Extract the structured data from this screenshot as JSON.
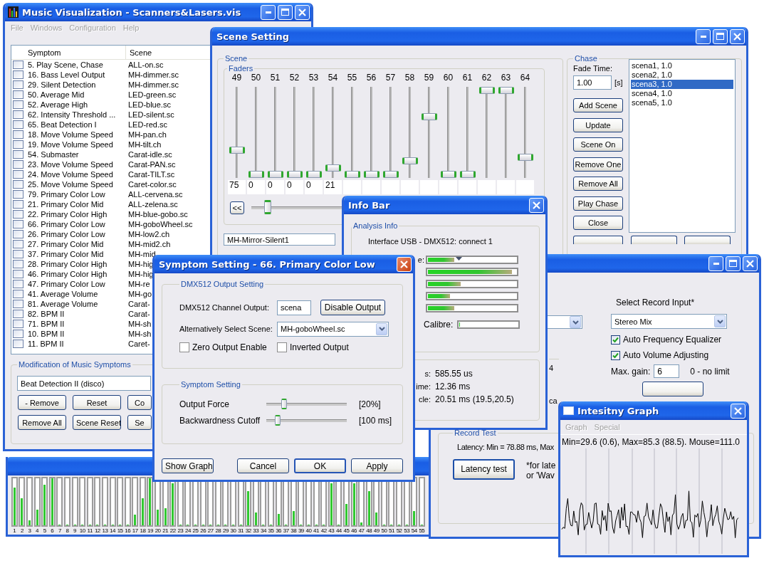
{
  "main_window": {
    "title": "Music Visualization - Scanners&Lasers.vis",
    "menu": [
      {
        "label": "File",
        "disabled": true
      },
      {
        "label": "Windows",
        "disabled": true
      },
      {
        "label": "Configuration",
        "disabled": true
      },
      {
        "label": "Help",
        "disabled": true
      }
    ],
    "list": {
      "columns": [
        "Symptom",
        "Scene"
      ],
      "rows": [
        {
          "symptom": "5. Play Scene, Chase",
          "scene": "ALL-on.sc",
          "checked": false
        },
        {
          "symptom": "16. Bass Level Output",
          "scene": "MH-dimmer.sc",
          "checked": false
        },
        {
          "symptom": "29. Silent Detection",
          "scene": "MH-dimmer.sc",
          "checked": false
        },
        {
          "symptom": "50. Average Mid",
          "scene": "LED-green.sc",
          "checked": false
        },
        {
          "symptom": "52. Average High",
          "scene": "LED-blue.sc",
          "checked": false
        },
        {
          "symptom": "62. Intensity Threshold ...",
          "scene": "LED-silent.sc",
          "checked": false
        },
        {
          "symptom": "65. Beat Detection I",
          "scene": "LED-red.sc",
          "checked": false
        },
        {
          "symptom": "18. Move Volume Speed",
          "scene": "MH-pan.ch",
          "checked": false
        },
        {
          "symptom": "19. Move Volume Speed",
          "scene": "MH-tilt.ch",
          "checked": false
        },
        {
          "symptom": "54. Submaster",
          "scene": "Carat-idle.sc",
          "checked": false
        },
        {
          "symptom": "23. Move Volume Speed",
          "scene": "Carat-PAN.sc",
          "checked": false
        },
        {
          "symptom": "24. Move Volume Speed",
          "scene": "Carat-TILT.sc",
          "checked": false
        },
        {
          "symptom": "25. Move Volume Speed",
          "scene": "Caret-color.sc",
          "checked": false
        },
        {
          "symptom": "79. Primary Color Low",
          "scene": "ALL-cervena.sc",
          "checked": false
        },
        {
          "symptom": "21. Primary Color Mid",
          "scene": "ALL-zelena.sc",
          "checked": false
        },
        {
          "symptom": "22. Primary Color High",
          "scene": "MH-blue-gobo.sc",
          "checked": false
        },
        {
          "symptom": "66. Primary Color Low",
          "scene": "MH-goboWheel.sc",
          "checked": false
        },
        {
          "symptom": "26. Primary Color Low",
          "scene": "MH-low2.ch",
          "checked": false
        },
        {
          "symptom": "27. Primary Color Mid",
          "scene": "MH-mid2.ch",
          "checked": false
        },
        {
          "symptom": "37. Primary Color Mid",
          "scene": "MH-mid",
          "checked": false
        },
        {
          "symptom": "28. Primary Color High",
          "scene": "MH-hig",
          "checked": false
        },
        {
          "symptom": "46. Primary Color High",
          "scene": "MH-hig",
          "checked": false
        },
        {
          "symptom": "47. Primary Color Low",
          "scene": "MH-re",
          "checked": false
        },
        {
          "symptom": "41. Average Volume",
          "scene": "MH-go",
          "checked": false
        },
        {
          "symptom": "81. Average Volume",
          "scene": "Carat-",
          "checked": false
        },
        {
          "symptom": "82. BPM II",
          "scene": "Carat-",
          "checked": false
        },
        {
          "symptom": "71. BPM II",
          "scene": "MH-sh",
          "checked": false
        },
        {
          "symptom": "10. BPM II",
          "scene": "MH-sh",
          "checked": false
        },
        {
          "symptom": "11. BPM II",
          "scene": "Caret-",
          "checked": false
        }
      ]
    },
    "modification": {
      "title": "Modification of Music Symptoms",
      "value": "Beat Detection II (disco)",
      "buttons": [
        "- Remove",
        "Reset",
        "Co",
        "Remove All",
        "Scene Reset",
        "Se"
      ]
    }
  },
  "meter_window": {
    "channels": [
      {
        "label": "1",
        "level": 0.8
      },
      {
        "label": "2",
        "level": 0.57
      },
      {
        "label": "3",
        "level": 0.1
      },
      {
        "label": "4",
        "level": 0.34
      },
      {
        "label": "5",
        "level": 0.87
      },
      {
        "label": "6",
        "level": 1
      },
      {
        "label": "7",
        "level": 0
      },
      {
        "label": "8",
        "level": 0
      },
      {
        "label": "9",
        "level": 0
      },
      {
        "label": "10",
        "level": 0
      },
      {
        "label": "11",
        "level": 0
      },
      {
        "label": "12",
        "level": 0
      },
      {
        "label": "13",
        "level": 0
      },
      {
        "label": "14",
        "level": 0
      },
      {
        "label": "15",
        "level": 0
      },
      {
        "label": "16",
        "level": 0
      },
      {
        "label": "17",
        "level": 0.22
      },
      {
        "label": "18",
        "level": 0.57
      },
      {
        "label": "19",
        "level": 1
      },
      {
        "label": "20",
        "level": 0.34
      },
      {
        "label": "21",
        "level": 0.36
      },
      {
        "label": "22",
        "level": 0.9
      },
      {
        "label": "23",
        "level": 0
      },
      {
        "label": "24",
        "level": 0
      },
      {
        "label": "25",
        "level": 0
      },
      {
        "label": "26",
        "level": 0
      },
      {
        "label": "27",
        "level": 0
      },
      {
        "label": "28",
        "level": 0
      },
      {
        "label": "29",
        "level": 0
      },
      {
        "label": "30",
        "level": 0
      },
      {
        "label": "31",
        "level": 0
      },
      {
        "label": "32",
        "level": 0.73
      },
      {
        "label": "33",
        "level": 0.27
      },
      {
        "label": "34",
        "level": 0
      },
      {
        "label": "35",
        "level": 0
      },
      {
        "label": "36",
        "level": 0.24
      },
      {
        "label": "37",
        "level": 0
      },
      {
        "label": "38",
        "level": 0.31
      },
      {
        "label": "39",
        "level": 0
      },
      {
        "label": "40",
        "level": 0
      },
      {
        "label": "41",
        "level": 0
      },
      {
        "label": "42",
        "level": 0
      },
      {
        "label": "43",
        "level": 0.9
      },
      {
        "label": "44",
        "level": 0
      },
      {
        "label": "45",
        "level": 0.45
      },
      {
        "label": "46",
        "level": 0.9
      },
      {
        "label": "47",
        "level": 0.06
      },
      {
        "label": "48",
        "level": 0.73
      },
      {
        "label": "49",
        "level": 0.27
      },
      {
        "label": "50",
        "level": 0
      },
      {
        "label": "51",
        "level": 0
      },
      {
        "label": "52",
        "level": 0
      },
      {
        "label": "53",
        "level": 0
      },
      {
        "label": "54",
        "level": 0.31
      },
      {
        "label": "55",
        "level": 0
      }
    ]
  },
  "scene_window": {
    "title": "Scene Setting",
    "scene_group": "Scene",
    "faders_group": "Faders",
    "faders": [
      {
        "channel": "49",
        "level": 0.29,
        "value": "75"
      },
      {
        "channel": "50",
        "level": 0,
        "value": "0"
      },
      {
        "channel": "51",
        "level": 0,
        "value": "0"
      },
      {
        "channel": "52",
        "level": 0,
        "value": "0"
      },
      {
        "channel": "53",
        "level": 0,
        "value": "0"
      },
      {
        "channel": "54",
        "level": 0.08,
        "value": "21"
      },
      {
        "channel": "55",
        "level": 0
      },
      {
        "channel": "56",
        "level": 0
      },
      {
        "channel": "57",
        "level": 0
      },
      {
        "channel": "58",
        "level": 0.16
      },
      {
        "channel": "59",
        "level": 0.69
      },
      {
        "channel": "60",
        "level": 0
      },
      {
        "channel": "61",
        "level": 0
      },
      {
        "channel": "62",
        "level": 1
      },
      {
        "channel": "63",
        "level": 1
      },
      {
        "channel": "64",
        "level": 0.2
      }
    ],
    "back_button": "<<",
    "position": {
      "level": 0.08
    },
    "scene_name": "MH-Mirror-Silent1",
    "chase": {
      "title": "Chase",
      "fade_label": "Fade Time:",
      "fade_value": "1.00",
      "unit": "[s]",
      "buttons": [
        "Add Scene",
        "Update",
        "Scene On",
        "Remove One",
        "Remove All",
        "Play Chase",
        "Close"
      ],
      "items": [
        {
          "label": "scena1, 1.0",
          "selected": false
        },
        {
          "label": "scena2, 1.0",
          "selected": false
        },
        {
          "label": "scena3, 1.0",
          "selected": true
        },
        {
          "label": "scena4, 1.0",
          "selected": false
        },
        {
          "label": "scena5, 1.0",
          "selected": false
        }
      ]
    }
  },
  "record_window": {
    "fragment_1": "4",
    "fragment_2": "ca",
    "input_label": "Select Record Input*",
    "input_value": "Stereo Mix",
    "options": [
      {
        "label": "Auto Frequency Equalizer",
        "checked": true
      },
      {
        "label": "Auto Volume Adjusting",
        "checked": true
      }
    ],
    "gain_label": "Max. gain:",
    "gain_value": "6",
    "gain_hint": "0 - no limit",
    "test": {
      "title": "Record Test",
      "latency": "Latency: Min = 78.88 ms, Max",
      "button": "Latency test",
      "note_lines": [
        "*for late",
        "or 'Wav"
      ]
    }
  },
  "info_bar": {
    "title": "Info Bar",
    "group": "Analysis Info",
    "interface": "Interface USB - DMX512: connect 1",
    "meters": [
      {
        "label": "e:",
        "level": 0.3
      },
      {
        "level": 0.95
      },
      {
        "level": 0.37
      },
      {
        "level": 0.25
      },
      {
        "level": 0.3
      }
    ],
    "calibre": {
      "label": "Calibre:",
      "level": 0
    },
    "stats": [
      {
        "label": "s:",
        "value": "585.55 us"
      },
      {
        "label": "ime:",
        "value": "12.36 ms"
      },
      {
        "label": "cle:",
        "value": "20.51 ms (19.5,20.5)"
      }
    ]
  },
  "graph_window": {
    "title": "Intesitny Graph",
    "menu": [
      {
        "label": "Graph",
        "disabled": true
      },
      {
        "label": "Special",
        "disabled": true
      }
    ],
    "stats": "Min=29.6 (0.6), Max=85.3 (88.5). Mouse=111.0"
  },
  "symptom_dialog": {
    "title": "Symptom Setting - 66. Primary Color Low",
    "output_group": "DMX512 Output Setting",
    "channel_label": "DMX512 Channel Output:",
    "channel_value": "scena",
    "disable_button": "Disable Output",
    "scene_label": "Alternatively Select Scene:",
    "scene_value": "MH-goboWheel.sc",
    "checks": [
      {
        "label": "Zero Output Enable",
        "checked": false
      },
      {
        "label": "Inverted Output",
        "checked": false
      }
    ],
    "symptom_group": "Symptom Setting",
    "sliders": [
      {
        "label": "Output Force",
        "level": 0.2,
        "reading": "[20%]"
      },
      {
        "label": "Backwardness Cutoff",
        "level": 0.12,
        "reading": "[100 ms]"
      }
    ],
    "graph_button": "Show Graph",
    "buttons": [
      {
        "label": "Cancel",
        "default": false
      },
      {
        "label": "OK",
        "default": true
      },
      {
        "label": "Apply",
        "default": false
      }
    ]
  }
}
